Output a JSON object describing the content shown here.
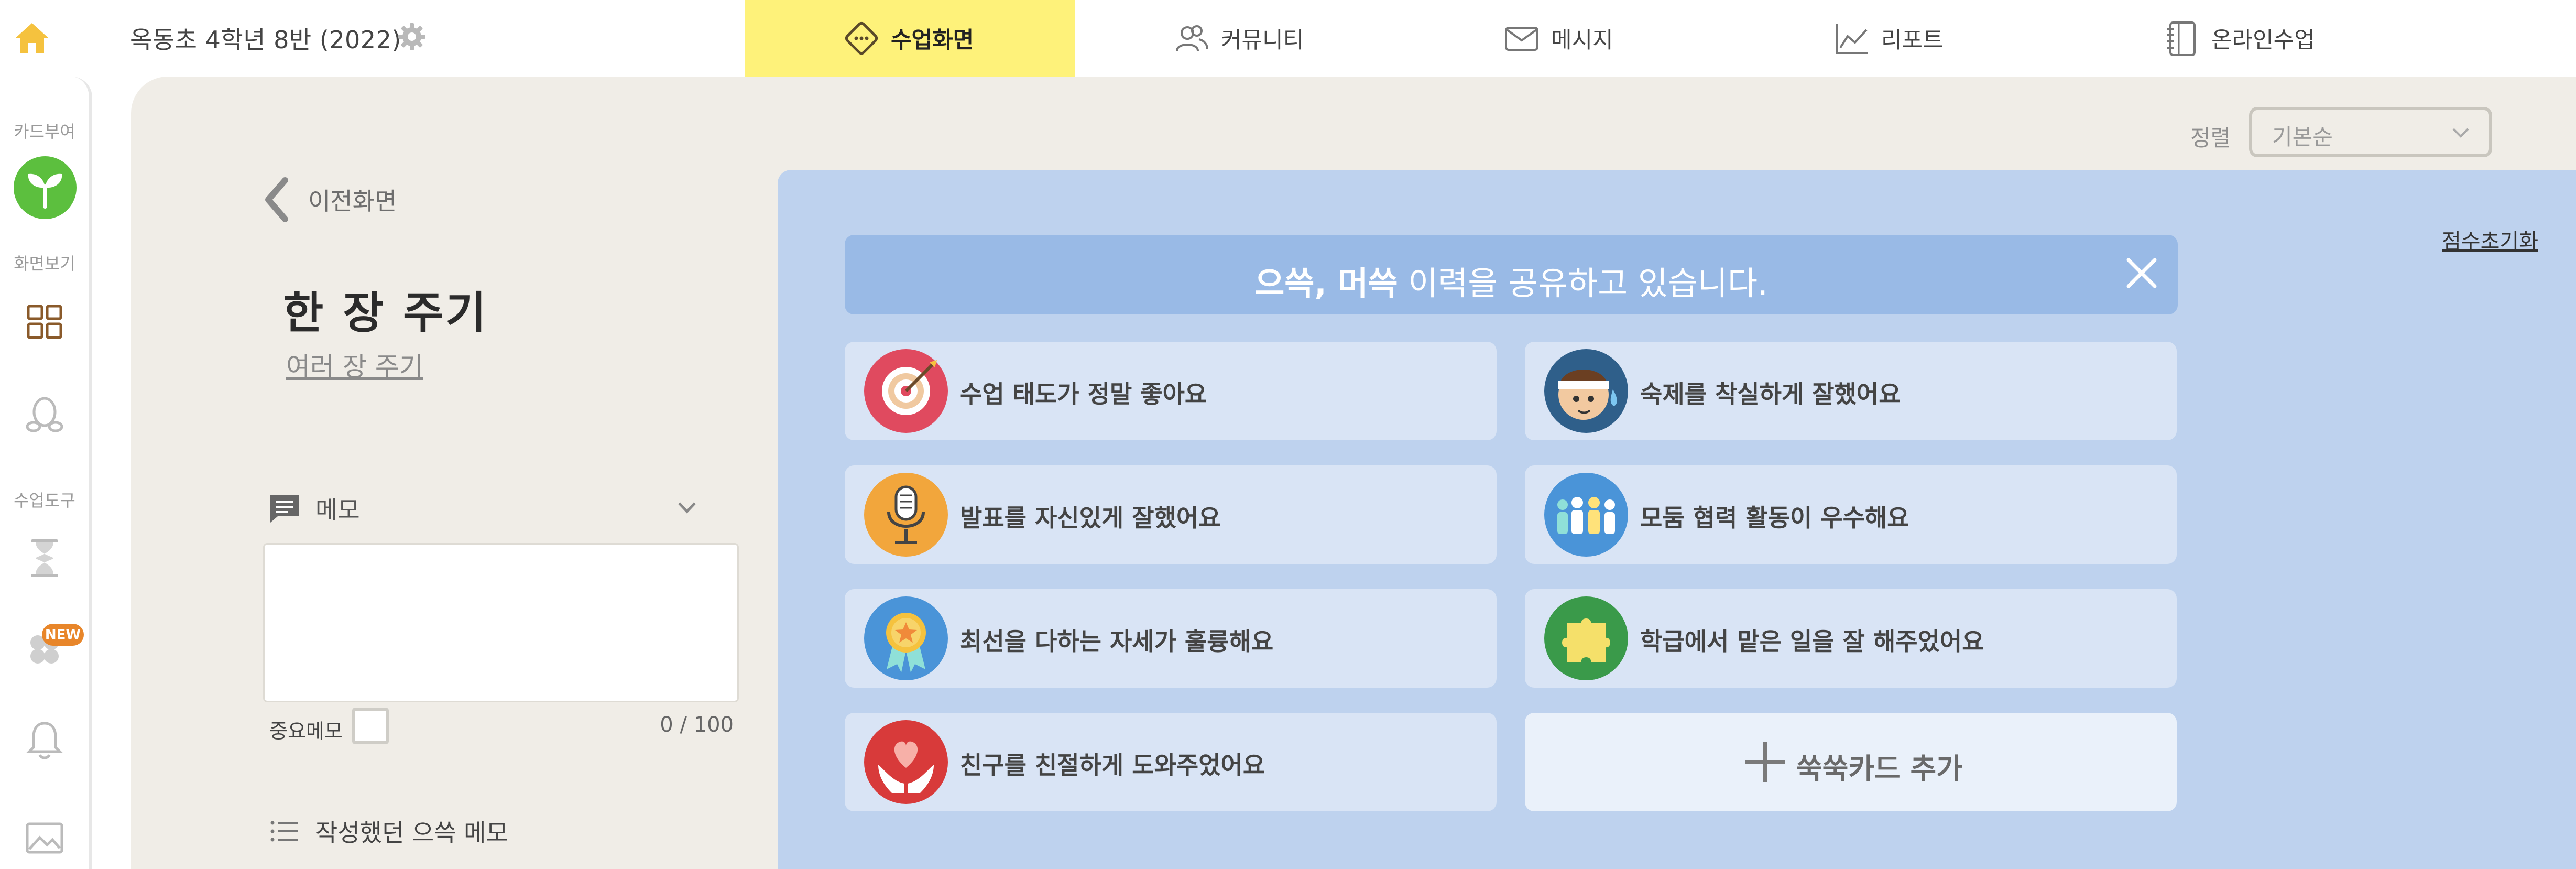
{
  "header": {
    "class_title": "옥동초 4학년 8반 (2022)",
    "nav": [
      {
        "label": "수업화면",
        "active": true,
        "icon": "lesson-icon"
      },
      {
        "label": "커뮤니티",
        "active": false,
        "icon": "community-icon"
      },
      {
        "label": "메시지",
        "active": false,
        "icon": "message-icon"
      },
      {
        "label": "리포트",
        "active": false,
        "icon": "report-icon"
      },
      {
        "label": "온라인수업",
        "active": false,
        "icon": "online-class-icon"
      }
    ]
  },
  "sidebar": {
    "card_give_label": "카드부여",
    "screen_view_label": "화면보기",
    "class_tools_label": "수업도구",
    "new_badge": "NEW",
    "icons": [
      "sprout-icon",
      "grid-icon",
      "egg-icon",
      "hourglass-icon",
      "clover-icon",
      "bell-icon",
      "image-icon"
    ]
  },
  "sort": {
    "label": "정렬",
    "value": "기본순"
  },
  "left_panel": {
    "back_label": "이전화면",
    "give_one": "한 장 주기",
    "give_many": "여러 장 주기",
    "memo_label": "메모",
    "memo_value": "",
    "important_memo_label": "중요메모",
    "memo_count": "0 / 100",
    "past_memo_label": "작성했던 으쓱 메모"
  },
  "panel": {
    "reset_label": "점수초기화",
    "banner": {
      "bold_1": "으쓱",
      "separator": ", ",
      "bold_2": "머쓱",
      "rest": " 이력을 공유하고 있습니다."
    },
    "cards": [
      {
        "label": "수업 태도가 정말 좋아요",
        "icon": "target-icon"
      },
      {
        "label": "숙제를 착실하게 잘했어요",
        "icon": "student-sweat-icon"
      },
      {
        "label": "발표를 자신있게 잘했어요",
        "icon": "microphone-icon"
      },
      {
        "label": "모둠 협력 활동이 우수해요",
        "icon": "team-icon"
      },
      {
        "label": "최선을 다하는 자세가 훌륭해요",
        "icon": "medal-icon"
      },
      {
        "label": "학급에서 맡은 일을 잘 해주었어요",
        "icon": "puzzle-icon"
      },
      {
        "label": "친구를 친절하게 도와주었어요",
        "icon": "heart-hands-icon"
      }
    ],
    "add_card_label": "쑥쑥카드 추가"
  },
  "colors": {
    "nav_active": "#fef27a",
    "panel_bg": "#bed2ee",
    "banner_bg": "#99bae6",
    "card_bg": "#d9e4f5",
    "main_bg": "#f0ede7",
    "home_icon": "#f5c23e",
    "sprout_green": "#5cbf3e"
  }
}
